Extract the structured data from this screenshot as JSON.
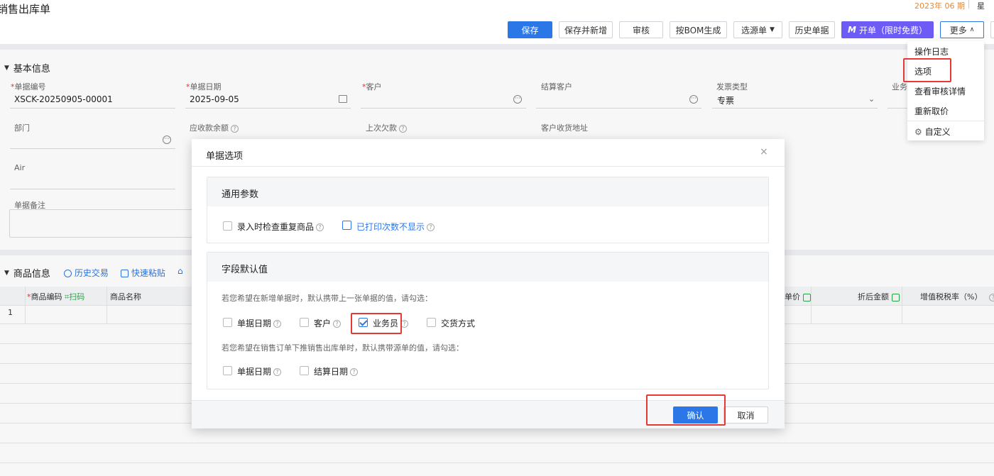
{
  "page": {
    "title": "销售出库单",
    "period": "2023年 06 期",
    "period_suffix": "星",
    "toolbar": {
      "save": "保存",
      "save_new": "保存并新增",
      "audit": "审核",
      "bom": "按BOM生成",
      "source": "选源单",
      "history": "历史单据",
      "invoice": "开单（限时免费）",
      "more": "更多"
    }
  },
  "more_menu": {
    "items": [
      "操作日志",
      "选项",
      "查看审核详情",
      "重新取价",
      "自定义"
    ]
  },
  "basic": {
    "section_title": "基本信息",
    "fields": {
      "doc_no_label": "单据编号",
      "doc_no_value": "XSCK-20250905-00001",
      "doc_date_label": "单据日期",
      "doc_date_value": "2025-09-05",
      "customer_label": "客户",
      "settle_customer_label": "结算客户",
      "invoice_type_label": "发票类型",
      "invoice_type_value": "专票",
      "salesman_label": "业务",
      "dept_label": "部门",
      "receivable_label": "应收款余额",
      "last_debt_label": "上次欠款",
      "address_label": "客户收货地址",
      "air_label": "Air",
      "remark_label": "单据备注"
    }
  },
  "goods": {
    "section_title": "商品信息",
    "history_link": "历史交易",
    "paste_link": "快速粘贴",
    "columns": {
      "code": "商品编码",
      "scan": "扫码",
      "name": "商品名称",
      "price_partial": "单价",
      "discount_amount": "折后金额",
      "tax_rate": "增值税税率（%）"
    },
    "row_no": "1"
  },
  "dialog": {
    "title": "单据选项",
    "general_title": "通用参数",
    "general_options": [
      {
        "label": "录入时检查重复商品",
        "checked": false
      },
      {
        "label": "已打印次数不显示",
        "checked": false
      }
    ],
    "defaults_title": "字段默认值",
    "hint1": "若您希望在新增单据时，默认携带上一张单据的值，请勾选：",
    "new_options": [
      {
        "label": "单据日期",
        "checked": false
      },
      {
        "label": "客户",
        "checked": false
      },
      {
        "label": "业务员",
        "checked": true
      },
      {
        "label": "交货方式",
        "checked": false
      }
    ],
    "hint2": "若您希望在销售订单下推销售出库单时，默认携带源单的值，请勾选：",
    "push_options": [
      {
        "label": "单据日期",
        "checked": false
      },
      {
        "label": "结算日期",
        "checked": false
      }
    ],
    "confirm": "确认",
    "cancel": "取消"
  },
  "colors": {
    "primary": "#2b77e8",
    "purple": "#6c5cf5",
    "highlight": "#e53935",
    "required": "#e53935"
  }
}
